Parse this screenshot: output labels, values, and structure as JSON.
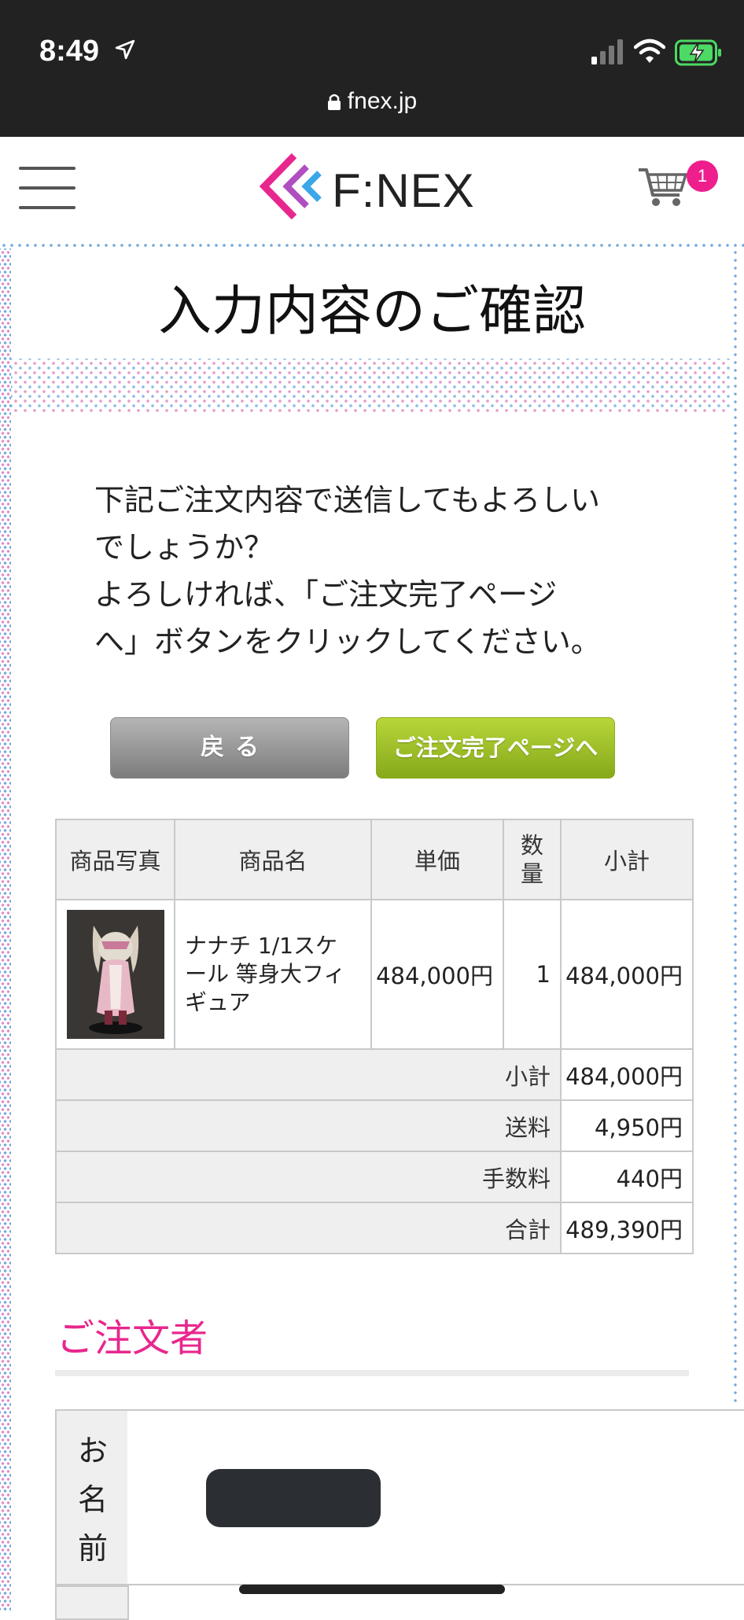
{
  "status_bar": {
    "time": "8:49",
    "url": "fnex.jp"
  },
  "header": {
    "logo_text": "F:NEX",
    "cart_count": "1"
  },
  "page": {
    "title": "入力内容のご確認",
    "message_lines": [
      "下記ご注文内容で送信してもよろしい",
      "でしょうか？",
      "よろしければ、「ご注文完了ページ",
      "へ」ボタンをクリックしてください。"
    ]
  },
  "buttons": {
    "back_label": "戻る",
    "complete_label": "ご注文完了ページへ"
  },
  "order_table": {
    "headers": {
      "photo": "商品写真",
      "name": "商品名",
      "price": "単価",
      "qty_line1": "数",
      "qty_line2": "量",
      "subtotal": "小計"
    },
    "item": {
      "name_lines": [
        "ナナチ 1/1スケ",
        "ール 等身大フィ",
        "ギュア"
      ],
      "price": "484,000円",
      "qty": "1",
      "subtotal": "484,000円"
    },
    "summary": [
      {
        "label": "小計",
        "value": "484,000円"
      },
      {
        "label": "送料",
        "value": "4,950円"
      },
      {
        "label": "手数料",
        "value": "440円"
      },
      {
        "label": "合計",
        "value": "489,390円"
      }
    ]
  },
  "orderer": {
    "section_title": "ご注文者",
    "name_label_chars": [
      "お",
      "名",
      "前"
    ]
  },
  "colors": {
    "accent_pink": "#e8278e",
    "button_green": "#9ebf24",
    "button_gray": "#9a9a9a"
  }
}
